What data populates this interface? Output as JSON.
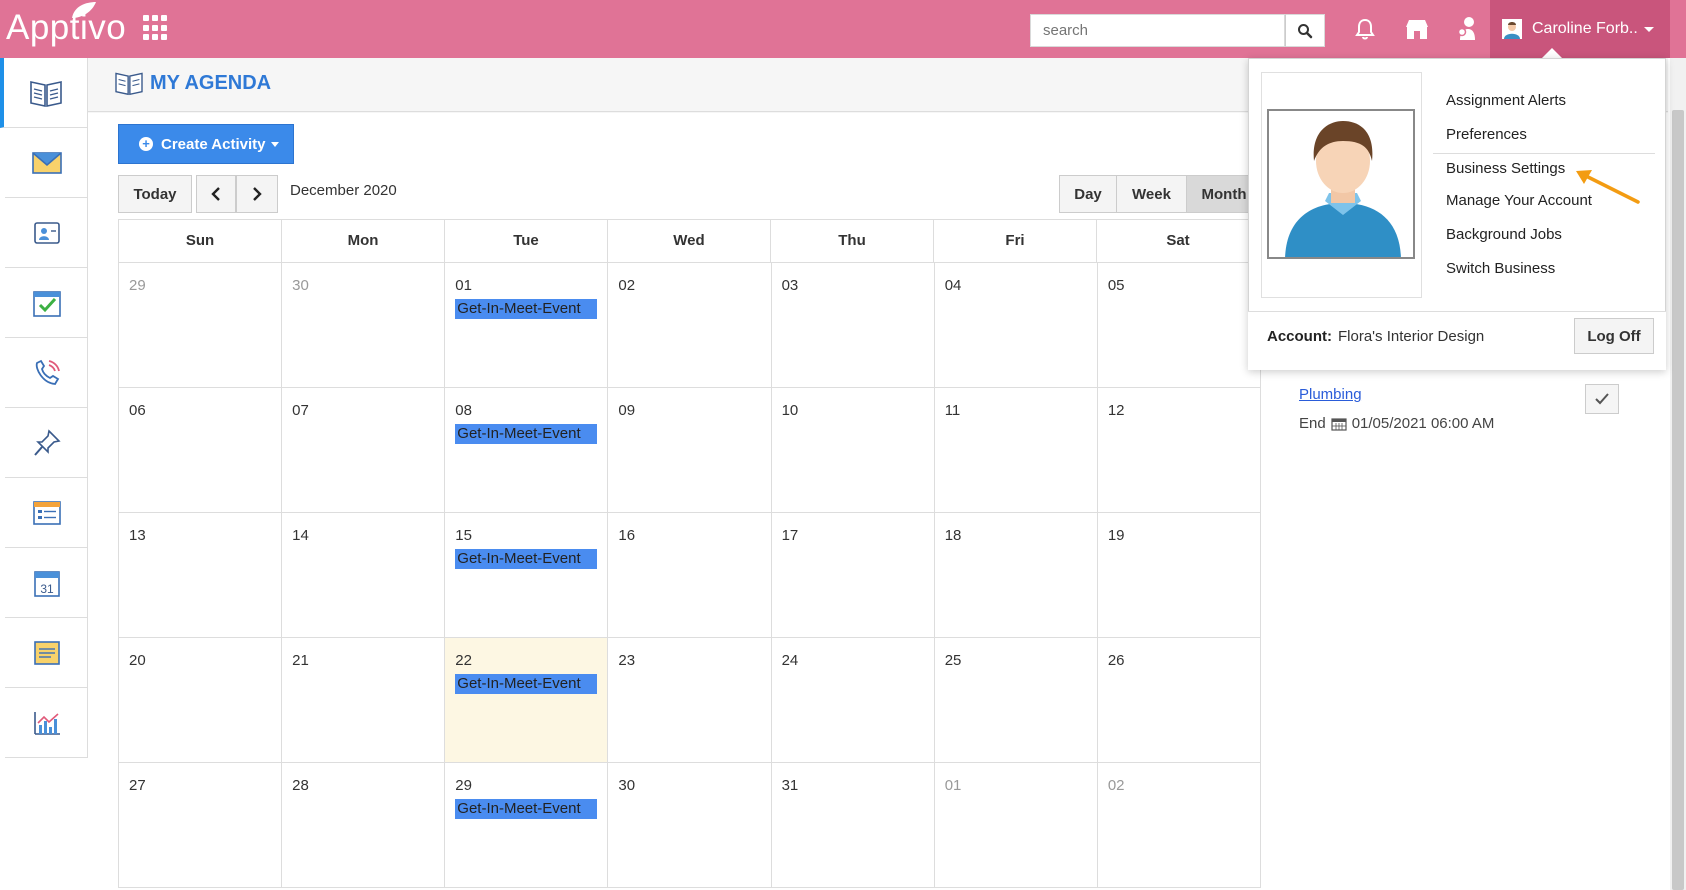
{
  "app": {
    "logo_text": "Apptivo",
    "brand_color": "#e07396"
  },
  "search": {
    "placeholder": "search"
  },
  "user": {
    "name": "Caroline Forb.."
  },
  "sidebar": {
    "items": [
      {
        "icon": "agenda-book-icon"
      },
      {
        "icon": "email-envelope-icon"
      },
      {
        "icon": "contacts-card-icon"
      },
      {
        "icon": "tasks-checkbox-icon"
      },
      {
        "icon": "call-log-icon"
      },
      {
        "icon": "pin-icon"
      },
      {
        "icon": "notes-list-icon"
      },
      {
        "icon": "calendar-icon"
      },
      {
        "icon": "sticky-notes-icon"
      },
      {
        "icon": "reports-chart-icon"
      }
    ],
    "calendar_day": "31"
  },
  "page": {
    "title": "MY AGENDA"
  },
  "toolbar": {
    "create_label": "Create Activity",
    "today_label": "Today",
    "month_label": "December 2020",
    "views": [
      "Day",
      "Week",
      "Month"
    ],
    "active_view": "Month"
  },
  "calendar": {
    "weekdays": [
      "Sun",
      "Mon",
      "Tue",
      "Wed",
      "Thu",
      "Fri",
      "Sat"
    ],
    "weeks": [
      [
        {
          "d": "29",
          "other": true
        },
        {
          "d": "30",
          "other": true
        },
        {
          "d": "01",
          "event": "Get-In-Meet-Event"
        },
        {
          "d": "02"
        },
        {
          "d": "03"
        },
        {
          "d": "04"
        },
        {
          "d": "05"
        }
      ],
      [
        {
          "d": "06"
        },
        {
          "d": "07"
        },
        {
          "d": "08",
          "event": "Get-In-Meet-Event"
        },
        {
          "d": "09"
        },
        {
          "d": "10"
        },
        {
          "d": "11"
        },
        {
          "d": "12"
        }
      ],
      [
        {
          "d": "13"
        },
        {
          "d": "14"
        },
        {
          "d": "15",
          "event": "Get-In-Meet-Event"
        },
        {
          "d": "16"
        },
        {
          "d": "17"
        },
        {
          "d": "18"
        },
        {
          "d": "19"
        }
      ],
      [
        {
          "d": "20"
        },
        {
          "d": "21"
        },
        {
          "d": "22",
          "event": "Get-In-Meet-Event",
          "today": true
        },
        {
          "d": "23"
        },
        {
          "d": "24"
        },
        {
          "d": "25"
        },
        {
          "d": "26"
        }
      ],
      [
        {
          "d": "27"
        },
        {
          "d": "28"
        },
        {
          "d": "29",
          "event": "Get-In-Meet-Event"
        },
        {
          "d": "30"
        },
        {
          "d": "31"
        },
        {
          "d": "01",
          "other": true
        },
        {
          "d": "02",
          "other": true
        }
      ]
    ]
  },
  "side_task": {
    "link": "Plumbing",
    "end_label": "End",
    "end_value": "01/05/2021 06:00 AM"
  },
  "dropdown": {
    "menu": [
      "Assignment Alerts",
      "Preferences",
      "Business Settings",
      "Manage Your Account",
      "Background Jobs",
      "Switch Business"
    ],
    "account_label": "Account:",
    "account_value": "Flora's Interior Design",
    "logoff_label": "Log Off",
    "highlight_color": "#f39c12"
  }
}
